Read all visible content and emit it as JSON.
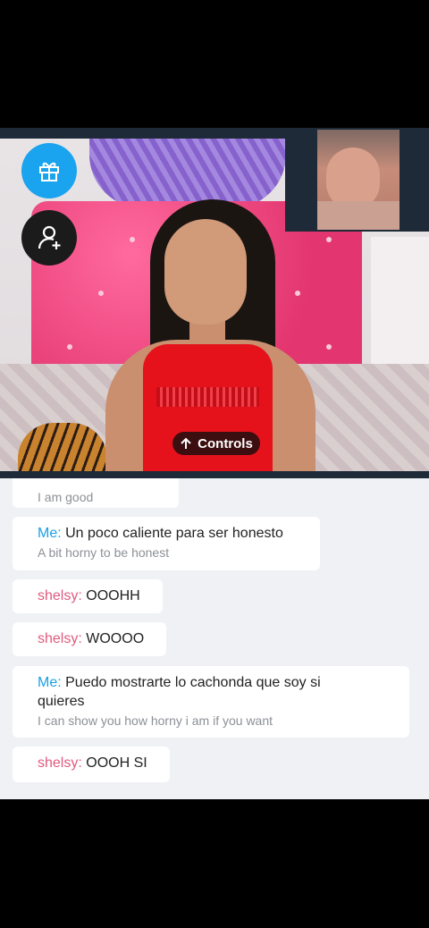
{
  "video": {
    "gift_icon": "gift-icon",
    "add_user_icon": "add-user-icon",
    "controls_label": "Controls",
    "controls_icon": "arrow-up-icon"
  },
  "chat": {
    "messages": [
      {
        "sender": "",
        "text": "",
        "translation": "I am good"
      },
      {
        "sender": "Me:",
        "text": "Un poco caliente para ser honesto",
        "translation": "A bit horny to be honest"
      },
      {
        "sender": "shelsy:",
        "text": "OOOHH",
        "translation": ""
      },
      {
        "sender": "shelsy:",
        "text": "WOOOO",
        "translation": ""
      },
      {
        "sender": "Me:",
        "text": "Puedo mostrarte lo cachonda que soy si quieres",
        "translation": "I can show you how horny i am if you want"
      },
      {
        "sender": "shelsy:",
        "text": "OOOH SI",
        "translation": ""
      }
    ]
  },
  "colors": {
    "me_sender": "#1a9fe5",
    "other_sender": "#e05a7e",
    "gift_button": "#1aa3ee"
  }
}
